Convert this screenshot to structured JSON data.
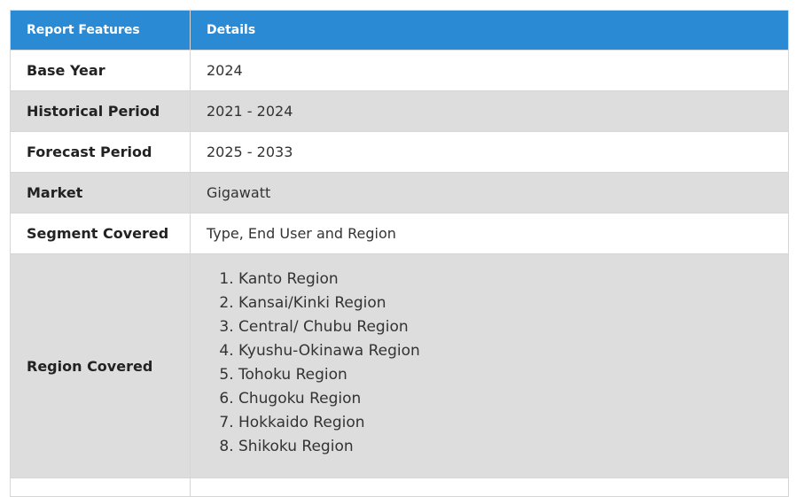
{
  "header": {
    "col1": "Report Features",
    "col2": "Details"
  },
  "rows": [
    {
      "feature": "Base Year",
      "detail": "2024"
    },
    {
      "feature": "Historical Period",
      "detail": "2021 - 2024"
    },
    {
      "feature": "Forecast Period",
      "detail": "2025 - 2033"
    },
    {
      "feature": "Market",
      "detail": "Gigawatt"
    },
    {
      "feature": "Segment Covered",
      "detail": "Type, End User and Region"
    }
  ],
  "region_row": {
    "feature": "Region Covered",
    "items": [
      "Kanto Region",
      "Kansai/Kinki Region",
      "Central/ Chubu Region",
      "Kyushu-Okinawa Region",
      "Tohoku Region",
      "Chugoku Region",
      "Hokkaido Region",
      "Shikoku Region"
    ]
  }
}
